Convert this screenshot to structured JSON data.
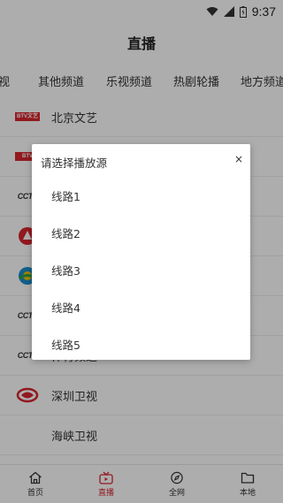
{
  "status_bar": {
    "time": "9:37",
    "icons": [
      "wifi-icon",
      "signal-icon",
      "battery-icon"
    ]
  },
  "header": {
    "title": "直播"
  },
  "tabs": [
    "视",
    "其他频道",
    "乐视频道",
    "热剧轮播",
    "地方频道"
  ],
  "channels": [
    {
      "logo_text": "BTV文艺",
      "name": "北京文艺"
    },
    {
      "logo_text": "BTV",
      "name": ""
    },
    {
      "logo_text": "CCTV",
      "name": ""
    },
    {
      "logo_text": "",
      "name": ""
    },
    {
      "logo_text": "",
      "name": ""
    },
    {
      "logo_text": "CCTV",
      "name": ""
    },
    {
      "logo_text": "CCTV",
      "name": "体育频道"
    },
    {
      "logo_text": "",
      "name": "深圳卫视"
    },
    {
      "logo_text": "",
      "name": "海峡卫视"
    }
  ],
  "dialog": {
    "title": "请选择播放源",
    "close": "×",
    "options": [
      "线路1",
      "线路2",
      "线路3",
      "线路4",
      "线路5"
    ]
  },
  "bottom_nav": [
    {
      "label": "首页",
      "icon": "home-icon",
      "active": false
    },
    {
      "label": "直播",
      "icon": "tv-icon",
      "active": true
    },
    {
      "label": "全网",
      "icon": "compass-icon",
      "active": false
    },
    {
      "label": "本地",
      "icon": "folder-icon",
      "active": false
    }
  ],
  "colors": {
    "accent": "#d8262f",
    "overlay": "rgba(0,0,0,0.32)"
  }
}
